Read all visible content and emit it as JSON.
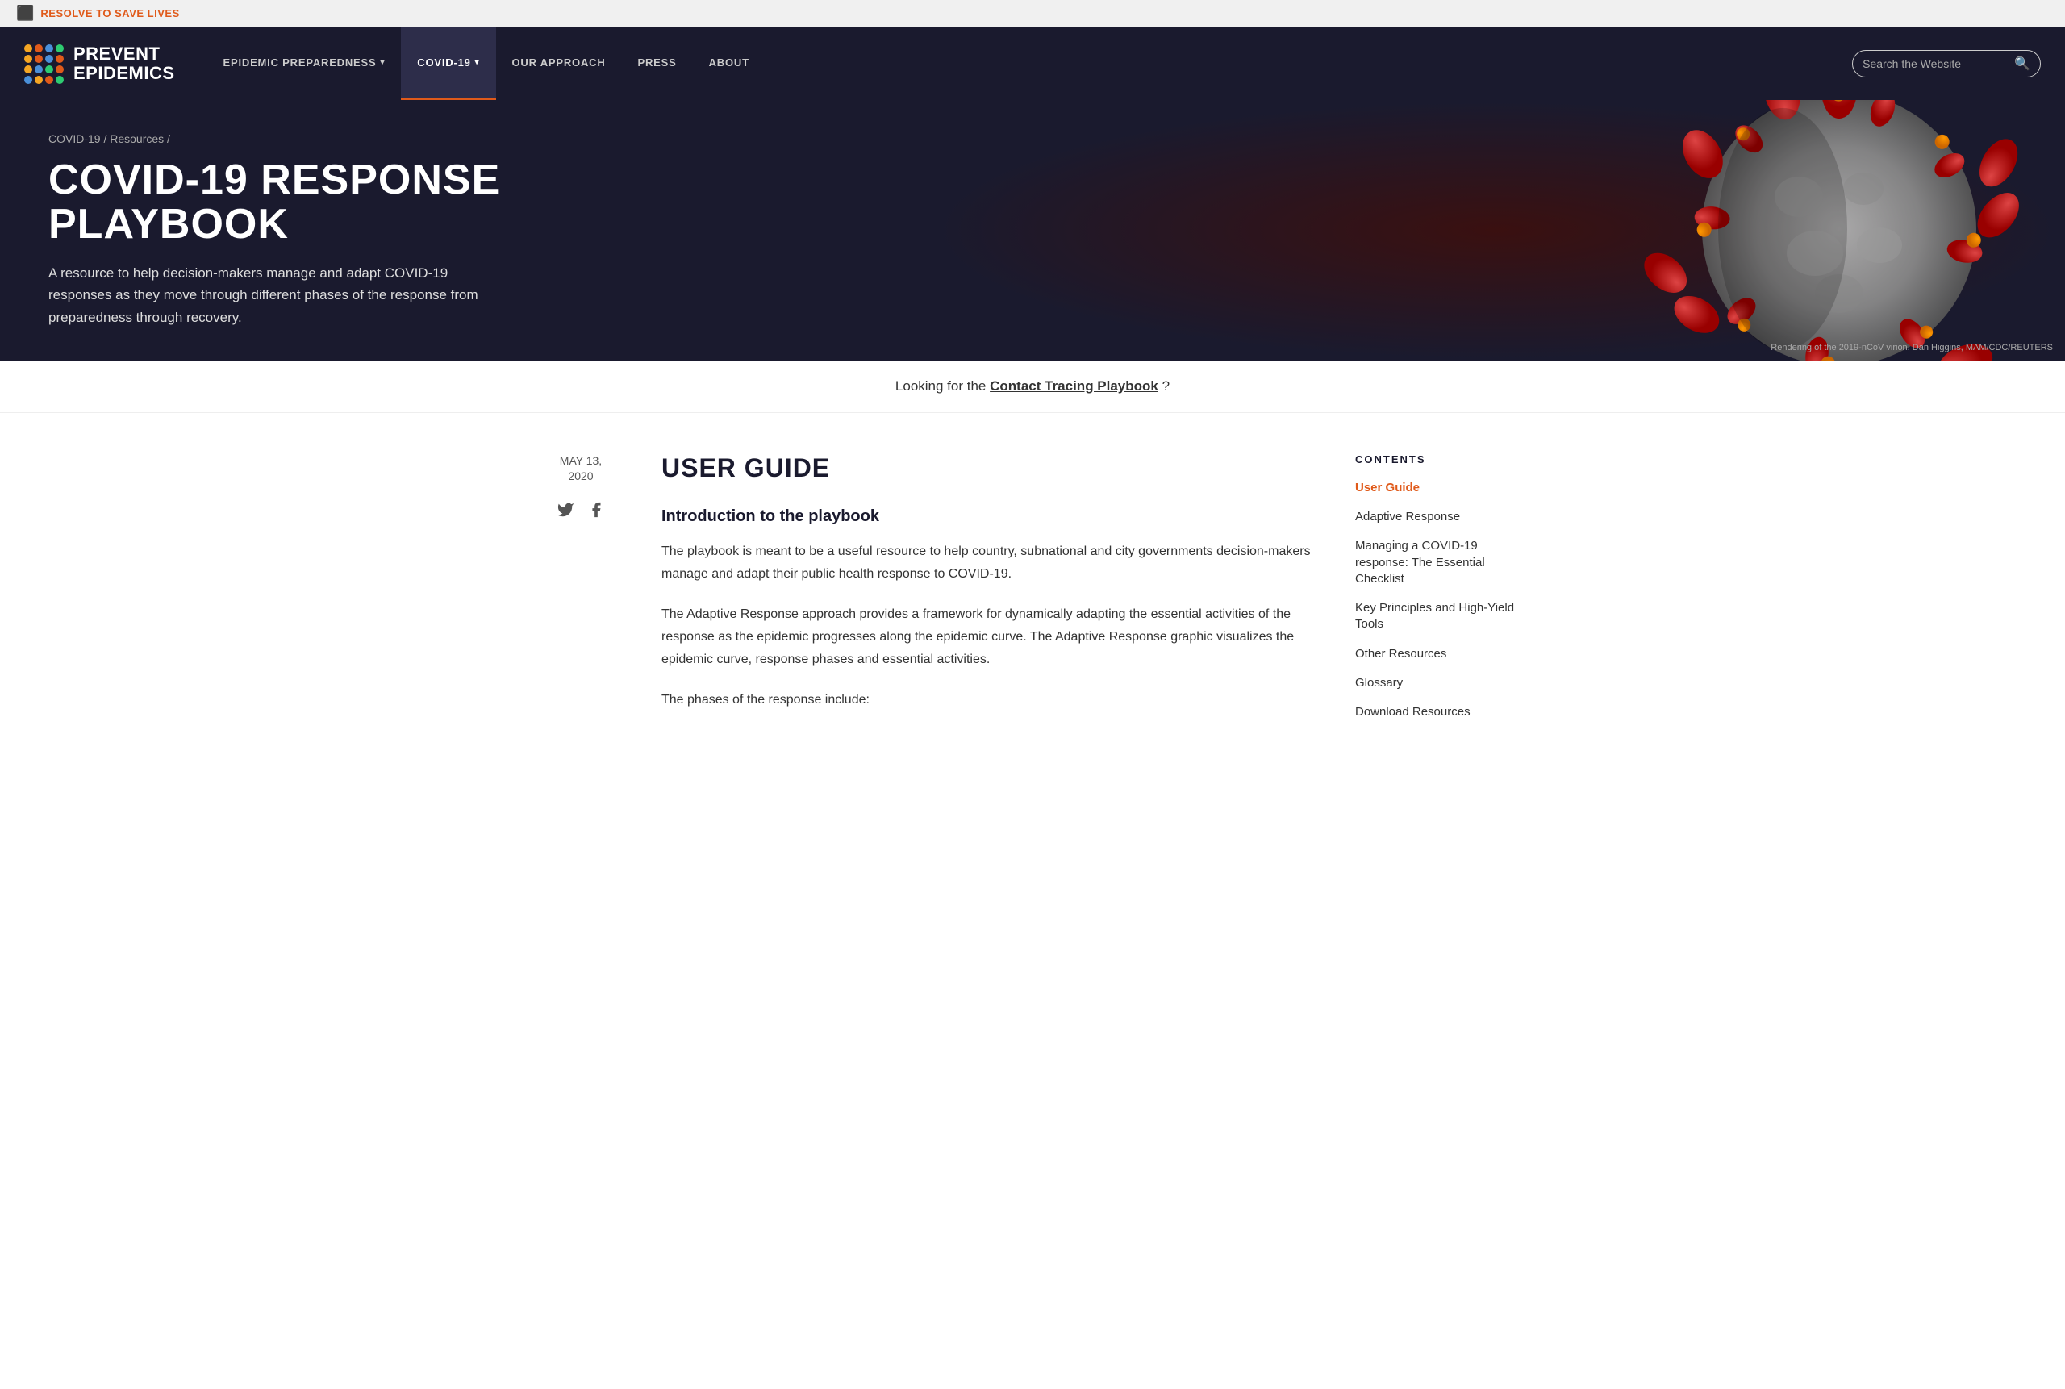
{
  "topbar": {
    "icon": "⬛",
    "text": "RESOLVE TO SAVE LIVES"
  },
  "nav": {
    "logo_line1": "PREVENT",
    "logo_line2": "EPIDEMICS",
    "items": [
      {
        "label": "EPIDEMIC PREPAREDNESS",
        "hasDropdown": true,
        "active": false
      },
      {
        "label": "COVID-19",
        "hasDropdown": true,
        "active": true
      },
      {
        "label": "OUR APPROACH",
        "hasDropdown": false,
        "active": false
      },
      {
        "label": "PRESS",
        "hasDropdown": false,
        "active": false
      },
      {
        "label": "ABOUT",
        "hasDropdown": false,
        "active": false
      }
    ],
    "search_placeholder": "Search the Website"
  },
  "hero": {
    "breadcrumb": "COVID-19 / Resources /",
    "title": "COVID-19 RESPONSE PLAYBOOK",
    "description": "A resource to help decision-makers manage and adapt COVID-19 responses as they move through different phases of the response from preparedness through recovery.",
    "image_caption": "Rendering of the 2019-nCoV virion. Dan Higgins, MAM/CDC/REUTERS"
  },
  "contact_bar": {
    "text_before": "Looking for the ",
    "link_text": "Contact Tracing Playbook",
    "text_after": "?"
  },
  "article": {
    "date": "MAY 13,\n2020",
    "section_title": "USER GUIDE",
    "intro_subtitle": "Introduction to the playbook",
    "para1": "The playbook is meant to be a useful resource to help country, subnational and city governments decision-makers manage and adapt their public health response to COVID-19.",
    "para2": "The Adaptive Response approach provides a framework for dynamically adapting the essential activities of the response as the epidemic progresses along the epidemic curve. The Adaptive Response graphic visualizes the epidemic curve, response phases and essential activities.",
    "para3": "The phases of the response include:"
  },
  "toc": {
    "title": "CONTENTS",
    "items": [
      {
        "label": "User Guide",
        "active": true
      },
      {
        "label": "Adaptive Response",
        "active": false
      },
      {
        "label": "Managing a COVID-19 response: The Essential Checklist",
        "active": false
      },
      {
        "label": "Key Principles and High-Yield Tools",
        "active": false
      },
      {
        "label": "Other Resources",
        "active": false
      },
      {
        "label": "Glossary",
        "active": false
      },
      {
        "label": "Download Resources",
        "active": false
      }
    ]
  },
  "logo_dots": [
    {
      "color": "#f5a623"
    },
    {
      "color": "#e05a1a"
    },
    {
      "color": "#4a90d9"
    },
    {
      "color": "#2ecc71"
    },
    {
      "color": "#f5a623"
    },
    {
      "color": "#e05a1a"
    },
    {
      "color": "#4a90d9"
    },
    {
      "color": "#e05a1a"
    },
    {
      "color": "#f5a623"
    },
    {
      "color": "#4a90d9"
    },
    {
      "color": "#2ecc71"
    },
    {
      "color": "#e05a1a"
    },
    {
      "color": "#4a90d9"
    },
    {
      "color": "#f5a623"
    },
    {
      "color": "#e05a1a"
    },
    {
      "color": "#2ecc71"
    }
  ],
  "colors": {
    "accent": "#e05a1a",
    "nav_bg": "#1a1a2e",
    "hero_bg": "#1a1a2e"
  }
}
